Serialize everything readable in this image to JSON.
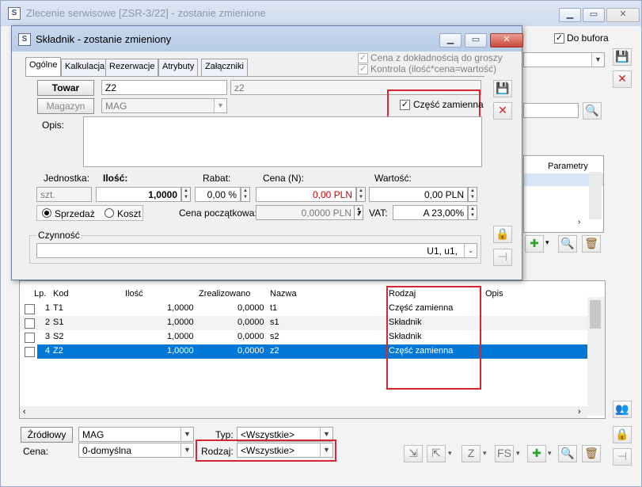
{
  "outer": {
    "title": "Zlecenie serwisowe [ZSR-3/22]  - zostanie zmienione",
    "do_bufora": "Do bufora",
    "grid_header_parametry": "Parametry"
  },
  "dialog": {
    "title": "Składnik - zostanie zmieniony",
    "tabs": [
      "Ogólne",
      "Kalkulacja",
      "Rezerwacje",
      "Atrybuty",
      "Załączniki"
    ],
    "cena_dokladnoscia": "Cena z dokładnością do groszy",
    "kontrola": "Kontrola (ilość*cena=wartość)",
    "towar_button": "Towar",
    "towar_code": "Z2",
    "towar_name": "z2",
    "magazyn_button": "Magazyn",
    "magazyn_value": "MAG",
    "czesc_zamienna": "Część zamienna",
    "opis_label": "Opis:",
    "jednostka_label": "Jednostka:",
    "ilosc_label": "Ilość:",
    "rabat_label": "Rabat:",
    "cena_label": "Cena (N):",
    "wartosc_label": "Wartość:",
    "jednostka_value": "szt.",
    "ilosc_value": "1,0000",
    "rabat_value": "0,00 %",
    "cena_value": "0,00 PLN",
    "wartosc_value": "0,00 PLN",
    "sprzedaz": "Sprzedaż",
    "koszt": "Koszt",
    "cena_poczatkowa_label": "Cena początkowa:",
    "cena_poczatkowa_value": "0,0000 PLN",
    "vat_label": "VAT:",
    "vat_value": "A 23,00%",
    "czynnosc_label": "Czynność",
    "czynnosc_value": "U1, u1,"
  },
  "table": {
    "headers": [
      "Lp.",
      "Kod",
      "Ilość",
      "Zrealizowano",
      "Nazwa",
      "Rodzaj",
      "Opis"
    ],
    "rows": [
      {
        "lp": "1",
        "kod": "T1",
        "ilosc": "1,0000",
        "zreal": "0,0000",
        "nazwa": "t1",
        "rodzaj": "Część zamienna"
      },
      {
        "lp": "2",
        "kod": "S1",
        "ilosc": "1,0000",
        "zreal": "0,0000",
        "nazwa": "s1",
        "rodzaj": "Składnik"
      },
      {
        "lp": "3",
        "kod": "S2",
        "ilosc": "1,0000",
        "zreal": "0,0000",
        "nazwa": "s2",
        "rodzaj": "Składnik"
      },
      {
        "lp": "4",
        "kod": "Z2",
        "ilosc": "1,0000",
        "zreal": "0,0000",
        "nazwa": "z2",
        "rodzaj": "Część zamienna"
      }
    ]
  },
  "bottom": {
    "zrodlowy_button": "Źródłowy",
    "zrodlowy_value": "MAG",
    "typ_label": "Typ:",
    "typ_value": "<Wszystkie>",
    "cena_label": "Cena:",
    "cena_value": "0-domyślna",
    "rodzaj_label": "Rodzaj:",
    "rodzaj_value": "<Wszystkie>"
  },
  "colors": {
    "selection": "#0078d7",
    "highlight_box": "#d9262e",
    "price_red": "#cc0000"
  }
}
